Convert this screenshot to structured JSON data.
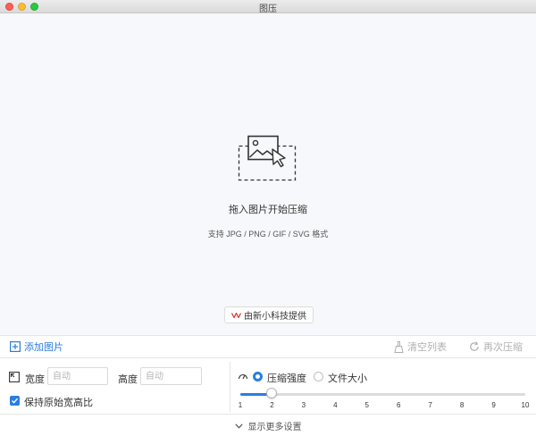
{
  "window": {
    "title": "图压"
  },
  "dropzone": {
    "title": "拖入图片开始压缩",
    "subtitle": "支持 JPG / PNG / GIF / SVG 格式",
    "icon": "image-upload-icon"
  },
  "credit": {
    "label": "由新小科技提供",
    "icon": "brand-logo-icon"
  },
  "toolbar": {
    "add_label": "添加图片",
    "clear_label": "清空列表",
    "recompress_label": "再次压缩"
  },
  "dimensions": {
    "width_label": "宽度",
    "width_placeholder": "自动",
    "height_label": "高度",
    "height_placeholder": "自动",
    "keep_ratio_label": "保持原始宽高比",
    "keep_ratio_checked": true
  },
  "compression": {
    "mode_strength_label": "压缩强度",
    "mode_filesize_label": "文件大小",
    "selected_mode": "压缩强度",
    "slider_value": 2,
    "slider_min": 1,
    "slider_max": 10,
    "ticks": [
      "1",
      "2",
      "3",
      "4",
      "5",
      "6",
      "7",
      "8",
      "9",
      "10"
    ]
  },
  "footer": {
    "more_settings_label": "显示更多设置"
  },
  "colors": {
    "accent": "#2b7de1",
    "muted": "#b0b0b0",
    "dropzone_bg": "#f7f8fb"
  }
}
